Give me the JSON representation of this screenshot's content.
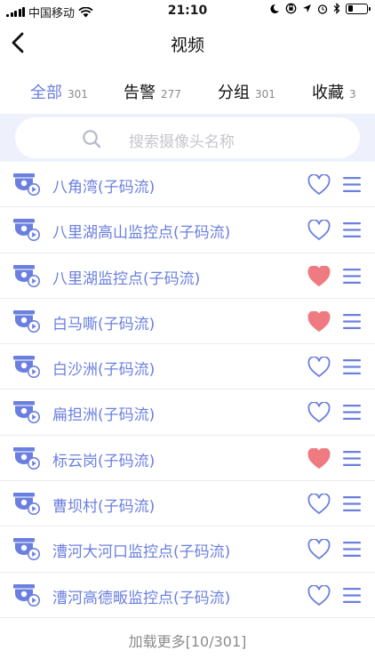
{
  "status_bar": {
    "carrier": "中国移动",
    "time": "21:10",
    "battery_level": 0.3
  },
  "nav": {
    "title": "视频",
    "back_icon": "chevron-left-icon"
  },
  "tabs": [
    {
      "label": "全部",
      "count": "301",
      "active": true
    },
    {
      "label": "告警",
      "count": "277",
      "active": false
    },
    {
      "label": "分组",
      "count": "301",
      "active": false
    },
    {
      "label": "收藏",
      "count": "3",
      "active": false
    }
  ],
  "search": {
    "placeholder": "搜索摄像头名称",
    "icon": "search-icon"
  },
  "colors": {
    "accent": "#6b7fe0",
    "favorite": "#f07a82",
    "search_band": "#eef0fc"
  },
  "cameras": [
    {
      "name": "八角湾(子码流)",
      "favorite": false
    },
    {
      "name": "八里湖高山监控点(子码流)",
      "favorite": false
    },
    {
      "name": "八里湖监控点(子码流)",
      "favorite": true
    },
    {
      "name": "白马嘶(子码流)",
      "favorite": true
    },
    {
      "name": "白沙洲(子码流)",
      "favorite": false
    },
    {
      "name": "扁担洲(子码流)",
      "favorite": false
    },
    {
      "name": "标云岗(子码流)",
      "favorite": true
    },
    {
      "name": "曹坝村(子码流)",
      "favorite": false
    },
    {
      "name": "漕河大河口监控点(子码流)",
      "favorite": false
    },
    {
      "name": "漕河高德畈监控点(子码流)",
      "favorite": false
    }
  ],
  "load_more": "加载更多[10/301]"
}
